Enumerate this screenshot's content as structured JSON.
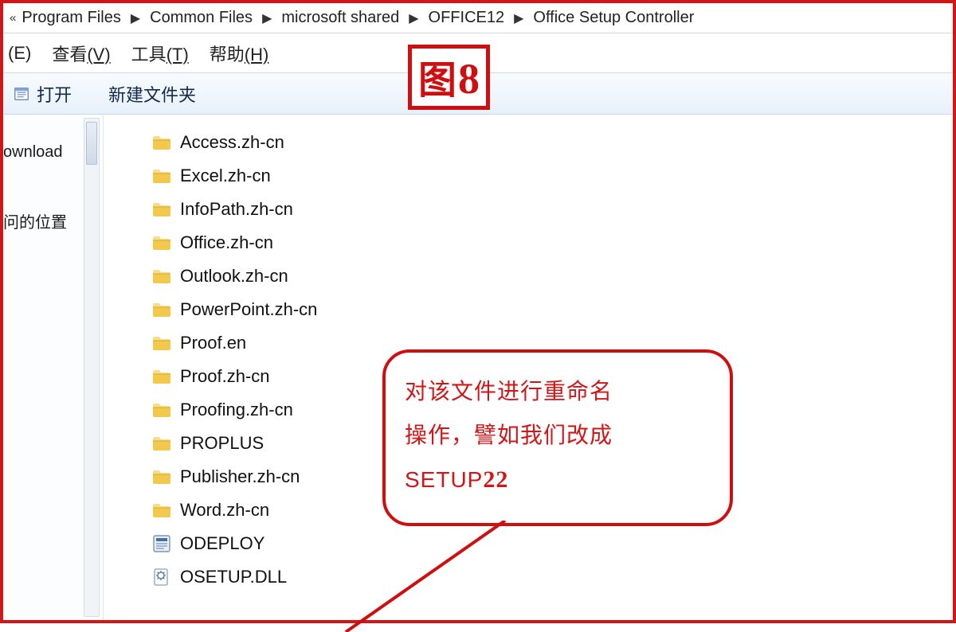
{
  "breadcrumbs": {
    "overflow_glyph": "«",
    "items": [
      "Program Files",
      "Common Files",
      "microsoft shared",
      "OFFICE12",
      "Office Setup Controller"
    ]
  },
  "menubar": {
    "edit": "(E)",
    "view": {
      "label": "查看",
      "mn": "(V)"
    },
    "tools": {
      "label": "工具",
      "mn": "(T)"
    },
    "help": {
      "label": "帮助",
      "mn": "(H)"
    }
  },
  "toolbar": {
    "open_label": "打开",
    "newfolder_label": "新建文件夹"
  },
  "nav": {
    "downloads": "ownload",
    "locations": "问的位置"
  },
  "files": [
    {
      "name": "Access.zh-cn",
      "type": "folder"
    },
    {
      "name": "Excel.zh-cn",
      "type": "folder"
    },
    {
      "name": "InfoPath.zh-cn",
      "type": "folder"
    },
    {
      "name": "Office.zh-cn",
      "type": "folder"
    },
    {
      "name": "Outlook.zh-cn",
      "type": "folder"
    },
    {
      "name": "PowerPoint.zh-cn",
      "type": "folder"
    },
    {
      "name": "Proof.en",
      "type": "folder"
    },
    {
      "name": "Proof.zh-cn",
      "type": "folder"
    },
    {
      "name": "Proofing.zh-cn",
      "type": "folder"
    },
    {
      "name": "PROPLUS",
      "type": "folder"
    },
    {
      "name": "Publisher.zh-cn",
      "type": "folder"
    },
    {
      "name": "Word.zh-cn",
      "type": "folder"
    },
    {
      "name": "ODEPLOY",
      "type": "bin"
    },
    {
      "name": "OSETUP.DLL",
      "type": "dll"
    }
  ],
  "annotation": {
    "figure_label": "图",
    "figure_number": "8",
    "callout_line1": "对该文件进行重命名",
    "callout_line2": "操作，譬如我们改成",
    "callout_line3a": "SETUP",
    "callout_line3b": "22"
  }
}
